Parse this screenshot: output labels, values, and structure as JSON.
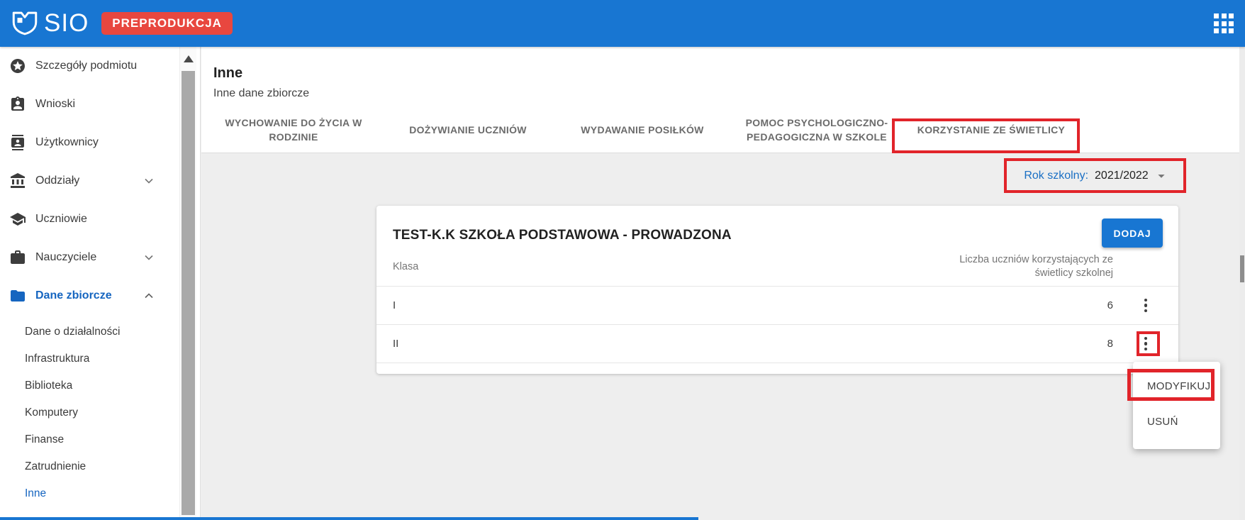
{
  "topbar": {
    "logo_text": "SIO",
    "environment_badge": "PREPRODUKCJA",
    "bar_color": "#1876d2",
    "badge_color": "#e8473f"
  },
  "sidebar": {
    "active_color": "#1565c0",
    "items": [
      {
        "label": "Szczegóły podmiotu",
        "icon": "star-circle-icon"
      },
      {
        "label": "Wnioski",
        "icon": "assignment-person-icon"
      },
      {
        "label": "Użytkownicy",
        "icon": "contact-card-icon"
      },
      {
        "label": "Oddziały",
        "icon": "bank-icon",
        "chevron": "down"
      },
      {
        "label": "Uczniowie",
        "icon": "graduation-cap-icon"
      },
      {
        "label": "Nauczyciele",
        "icon": "briefcase-icon",
        "chevron": "down"
      },
      {
        "label": "Dane zbiorcze",
        "icon": "folder-icon",
        "chevron": "up",
        "active": true
      }
    ],
    "subitems": [
      {
        "label": "Dane o działalności"
      },
      {
        "label": "Infrastruktura"
      },
      {
        "label": "Biblioteka"
      },
      {
        "label": "Komputery"
      },
      {
        "label": "Finanse"
      },
      {
        "label": "Zatrudnienie"
      },
      {
        "label": "Inne",
        "active": true
      }
    ]
  },
  "page": {
    "title": "Inne",
    "subtitle": "Inne dane zbiorcze"
  },
  "tabs": [
    {
      "label": "WYCHOWANIE DO ŻYCIA W RODZINIE"
    },
    {
      "label": "DOŻYWIANIE UCZNIÓW"
    },
    {
      "label": "WYDAWANIE POSIŁKÓW"
    },
    {
      "label": "POMOC PSYCHOLOGICZNO-PEDAGOGICZNA W SZKOLE"
    },
    {
      "label": "KORZYSTANIE ZE ŚWIETLICY",
      "selected": true,
      "annotated": true
    }
  ],
  "filter": {
    "label": "Rok szkolny:",
    "value": "2021/2022",
    "annotated": true
  },
  "card": {
    "title": "TEST-K.K SZKOŁA PODSTAWOWA - PROWADZONA",
    "add_button_label": "DODAJ",
    "columns": {
      "klasa": "Klasa",
      "liczba": "Liczba uczniów korzystających ze świetlicy szkolnej"
    },
    "rows": [
      {
        "klasa": "I",
        "liczba": "6"
      },
      {
        "klasa": "II",
        "liczba": "8",
        "menu_annotated": true
      }
    ]
  },
  "context_menu": {
    "items": [
      {
        "label": "MODYFIKUJ",
        "annotated": true
      },
      {
        "label": "USUŃ"
      }
    ]
  },
  "annotations": {
    "color": "#e1242a"
  }
}
